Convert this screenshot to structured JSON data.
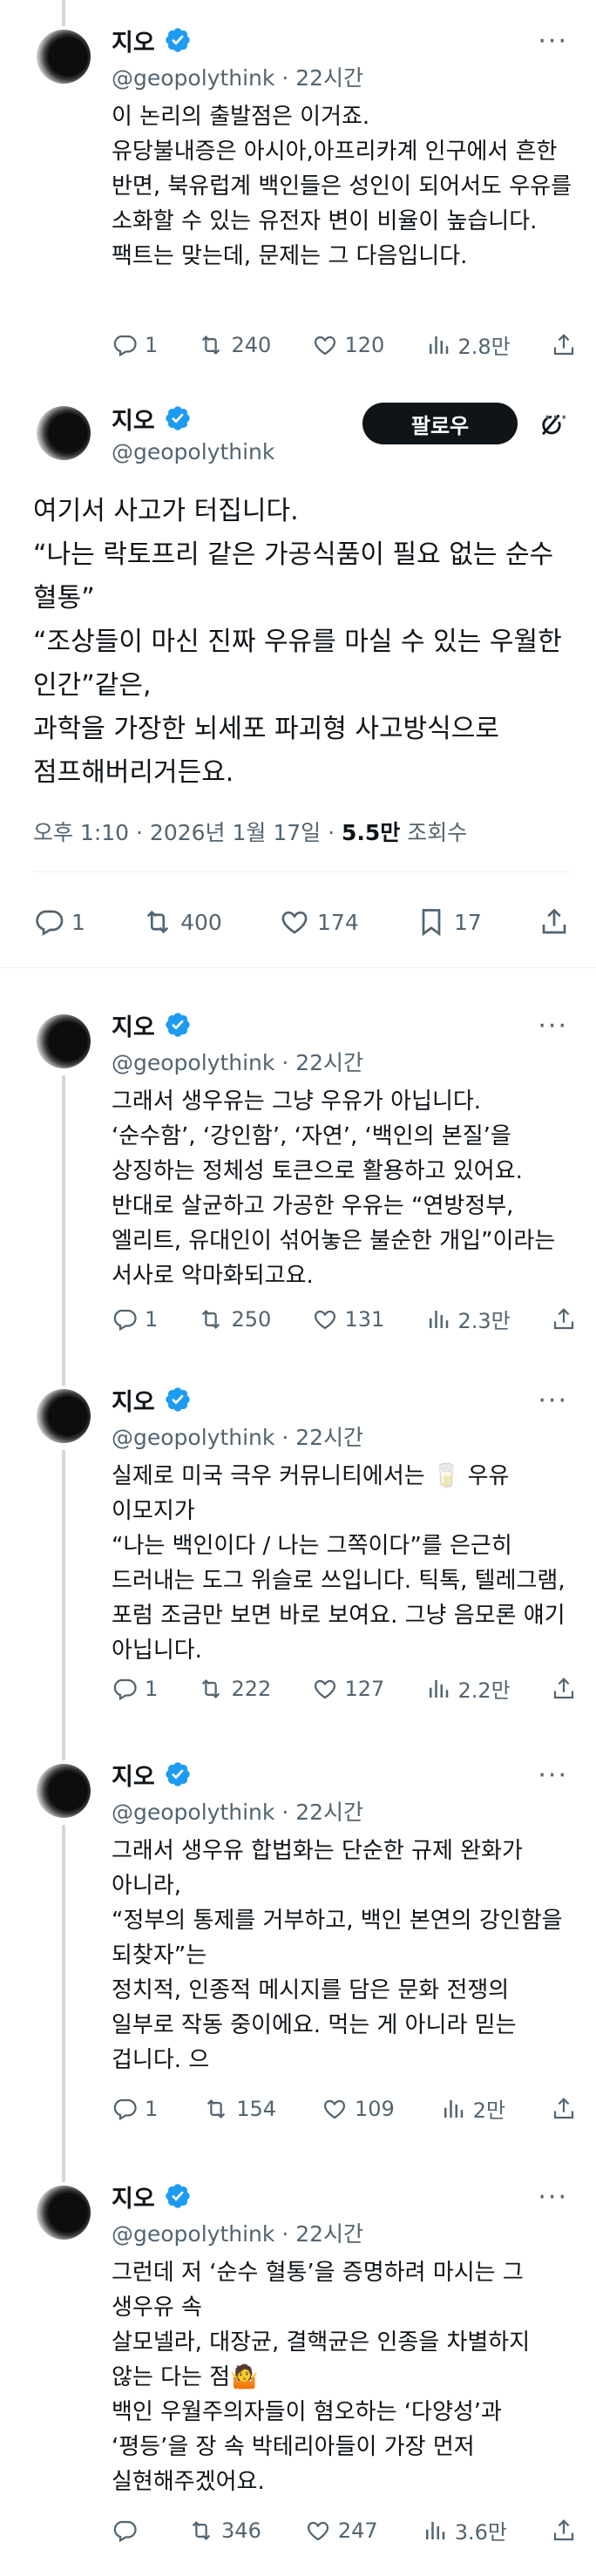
{
  "author": {
    "name": "지오",
    "handle": "@geopolythink"
  },
  "replies_top": [
    {
      "time": "22시간",
      "text": "이 논리의 출발점은 이거죠.\n유당불내증은 아시아,아프리카계 인구에서 흔한 반면, 북유럽계 백인들은 성인이 되어서도 우유를 소화할 수 있는 유전자 변이 비율이 높습니다. 팩트는 맞는데, 문제는 그 다음입니다.",
      "replies": "1",
      "reposts": "240",
      "likes": "120",
      "views": "2.8만"
    }
  ],
  "main": {
    "follow_label": "팔로우",
    "text": "여기서 사고가 터집니다.\n“나는 락토프리 같은 가공식품이 필요 없는 순수 혈통”\n“조상들이 마신 진짜 우유를 마실 수 있는 우월한 인간”같은,\n과학을 가장한 뇌세포 파괴형 사고방식으로 점프해버리거든요.",
    "timestamp": "오후 1:10 · 2026년 1월 17일 · ",
    "views_count": "5.5만",
    "views_label": " 조회수",
    "replies": "1",
    "reposts": "400",
    "likes": "174",
    "bookmarks": "17"
  },
  "replies_bottom": [
    {
      "time": "22시간",
      "text": "그래서 생우유는 그냥 우유가 아닙니다.\n‘순수함’, ‘강인함’, ‘자연’, ‘백인의 본질’을 상징하는 정체성 토큰으로 활용하고 있어요.\n반대로 살균하고 가공한 우유는 “연방정부, 엘리트, 유대인이 섞어놓은 불순한 개입”이라는 서사로 악마화되고요.",
      "replies": "1",
      "reposts": "250",
      "likes": "131",
      "views": "2.3만"
    },
    {
      "time": "22시간",
      "text": "실제로 미국 극우 커뮤니티에서는 🥛 우유 이모지가\n“나는 백인이다 / 나는 그쪽이다”를 은근히 드러내는 도그 위슬로 쓰입니다. 틱톡, 텔레그램, 포럼 조금만 보면 바로 보여요. 그냥 음모론 얘기 아닙니다.",
      "replies": "1",
      "reposts": "222",
      "likes": "127",
      "views": "2.2만"
    },
    {
      "time": "22시간",
      "text": "그래서 생우유 합법화는 단순한 규제 완화가 아니라,\n“정부의 통제를 거부하고, 백인 본연의 강인함을 되찾자”는\n정치적, 인종적 메시지를 담은 문화 전쟁의 일부로 작동 중이에요. 먹는 게 아니라 믿는 겁니다. 으",
      "replies": "1",
      "reposts": "154",
      "likes": "109",
      "views": "2만"
    },
    {
      "time": "22시간",
      "text": "그런데 저 ‘순수 혈통’을 증명하려 마시는 그 생우유 속\n살모넬라, 대장균, 결핵균은 인종을 차별하지 않는 다는 점🤷\n백인 우월주의자들이 혐오하는 ‘다양성’과 ‘평등’을 장 속 박테리아들이 가장 먼저 실현해주겠어요.",
      "replies": "",
      "reposts": "346",
      "likes": "247",
      "views": "3.6만"
    }
  ],
  "colors": {
    "text": "#0f1419",
    "muted": "#536471",
    "verified": "#1d9bf0",
    "line": "#cfd9de"
  }
}
